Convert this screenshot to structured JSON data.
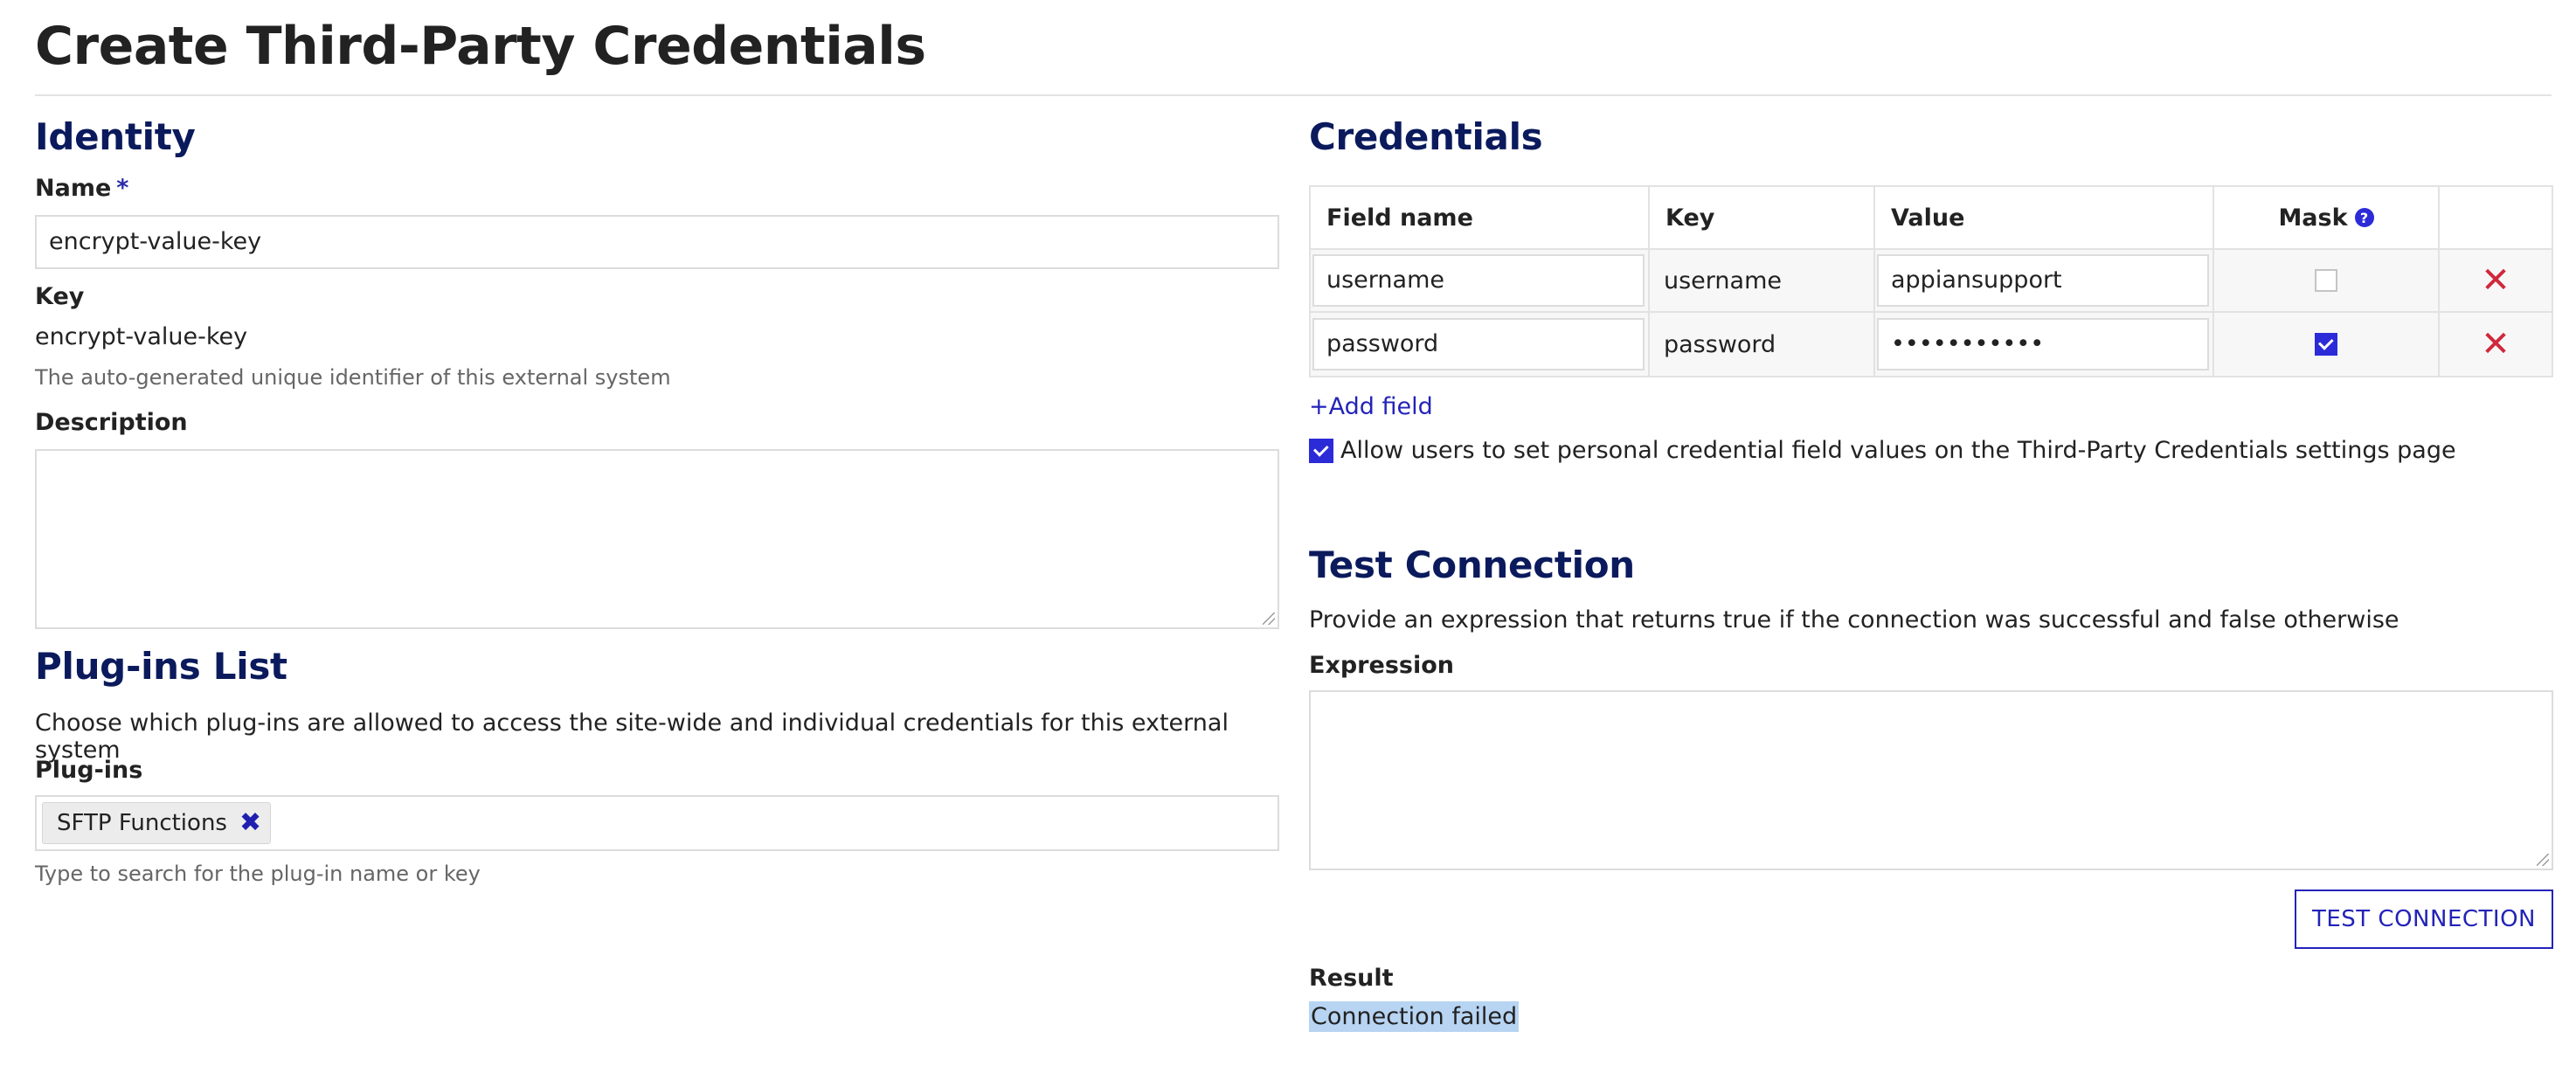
{
  "page": {
    "title": "Create Third-Party Credentials"
  },
  "identity": {
    "heading": "Identity",
    "name_label": "Name",
    "required_mark": "*",
    "name_value": "encrypt-value-key",
    "key_label": "Key",
    "key_value": "encrypt-value-key",
    "key_help": "The auto-generated unique identifier of this external system",
    "description_label": "Description",
    "description_value": ""
  },
  "plugins": {
    "heading": "Plug-ins List",
    "intro": "Choose which plug-ins are allowed to access the site-wide and individual credentials for this external system",
    "label": "Plug-ins",
    "selected": [
      "SFTP Functions"
    ],
    "help": "Type to search for the plug-in name or key"
  },
  "credentials": {
    "heading": "Credentials",
    "columns": [
      "Field name",
      "Key",
      "Value",
      "Mask",
      ""
    ],
    "rows": [
      {
        "field_name": "username",
        "key": "username",
        "value": "appiansupport",
        "mask": false
      },
      {
        "field_name": "password",
        "key": "password",
        "value": "•••••••••••",
        "mask": true
      }
    ],
    "add_field_label": "+Add field",
    "allow_personal_label": "Allow users to set personal credential field values on the Third-Party Credentials settings page",
    "allow_personal_checked": true
  },
  "test_connection": {
    "heading": "Test Connection",
    "intro": "Provide an expression that returns true if the connection was successful and false otherwise",
    "expression_label": "Expression",
    "expression_value": "",
    "button_label": "TEST CONNECTION",
    "result_label": "Result",
    "result_value": "Connection failed"
  },
  "colors": {
    "heading": "#0a1a5c",
    "accent": "#2b2bd8",
    "danger": "#d0273a",
    "highlight": "#b7d4f2"
  },
  "icons": {
    "remove_pill": "close-icon",
    "delete_row": "close-icon",
    "mask_help": "question-circle-icon"
  }
}
